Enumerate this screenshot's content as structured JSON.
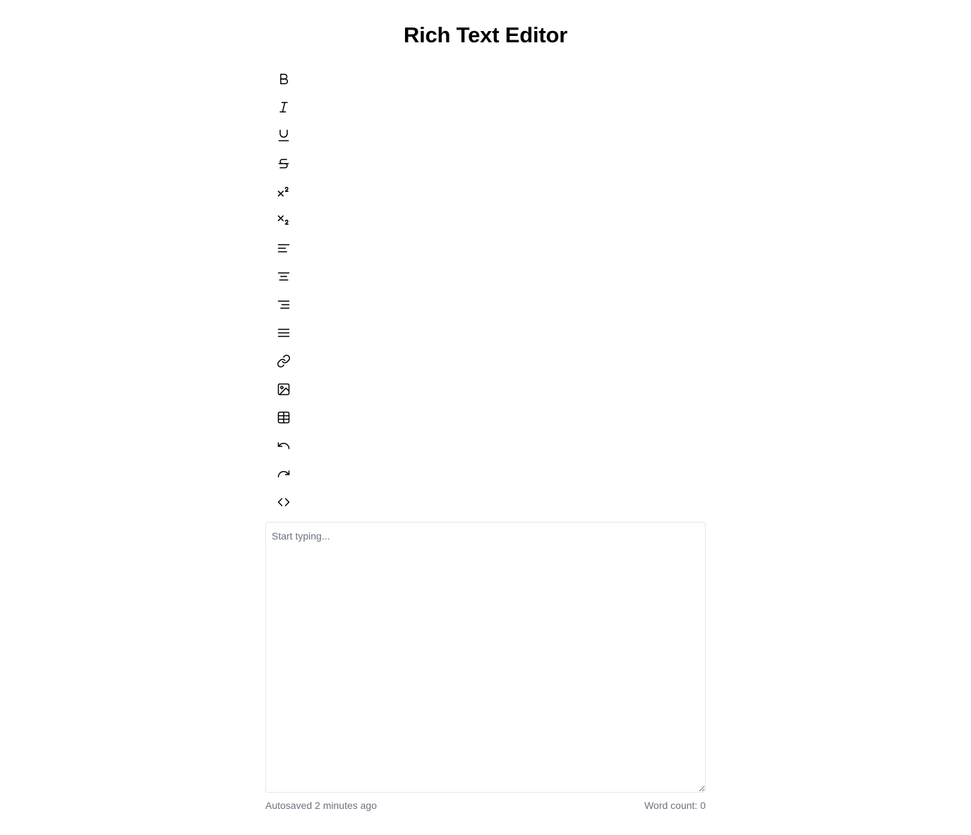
{
  "page": {
    "title": "Rich Text Editor"
  },
  "toolbar": {
    "buttons": [
      {
        "name": "bold",
        "icon": "bold-icon"
      },
      {
        "name": "italic",
        "icon": "italic-icon"
      },
      {
        "name": "underline",
        "icon": "underline-icon"
      },
      {
        "name": "strikethrough",
        "icon": "strikethrough-icon"
      },
      {
        "name": "superscript",
        "icon": "superscript-icon"
      },
      {
        "name": "subscript",
        "icon": "subscript-icon"
      },
      {
        "name": "align-left",
        "icon": "align-left-icon"
      },
      {
        "name": "align-center",
        "icon": "align-center-icon"
      },
      {
        "name": "align-right",
        "icon": "align-right-icon"
      },
      {
        "name": "align-justify",
        "icon": "align-justify-icon"
      },
      {
        "name": "link",
        "icon": "link-icon"
      },
      {
        "name": "image",
        "icon": "image-icon"
      },
      {
        "name": "table",
        "icon": "table-icon"
      },
      {
        "name": "undo",
        "icon": "undo-icon"
      },
      {
        "name": "redo",
        "icon": "redo-icon"
      },
      {
        "name": "code",
        "icon": "code-icon"
      }
    ]
  },
  "editor": {
    "value": "",
    "placeholder": "Start typing..."
  },
  "footer": {
    "autosave_status": "Autosaved 2 minutes ago",
    "word_count": "Word count: 0"
  },
  "colors": {
    "text": "#111111",
    "muted": "#6b7280",
    "border": "#e5e7eb",
    "background": "#ffffff"
  }
}
